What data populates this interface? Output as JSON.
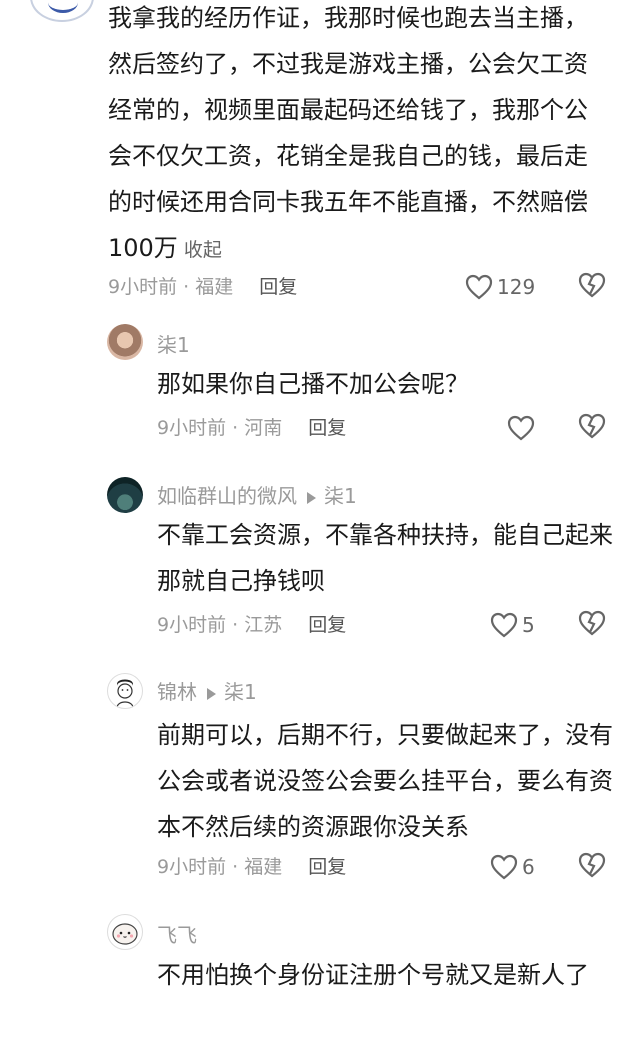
{
  "main_comment": {
    "text": "我拿我的经历作证，我那时候也跑去当主播，然后签约了，不过我是游戏主播，公会欠工资经常的，视频里面最起码还给钱了，我那个公会不仅欠工资，花销全是我自己的钱，最后走的时候还用合同卡我五年不能直播，不然赔偿100万",
    "expand_label": "收起",
    "time_location": "9小时前 · 福建",
    "reply_label": "回复",
    "likes": "129"
  },
  "replies": [
    {
      "name": "柒1",
      "reply_to": "",
      "text": "那如果你自己播不加公会呢？",
      "time_location": "9小时前 · 河南",
      "reply_label": "回复",
      "likes": ""
    },
    {
      "name": "如临群山的微风",
      "reply_to": "柒1",
      "text": "不靠工会资源，不靠各种扶持，能自己起来那就自己挣钱呗",
      "time_location": "9小时前 · 江苏",
      "reply_label": "回复",
      "likes": "5"
    },
    {
      "name": "锦林",
      "reply_to": "柒1",
      "text": "前期可以，后期不行，只要做起来了，没有公会或者说没签公会要么挂平台，要么有资本不然后续的资源跟你没关系",
      "time_location": "9小时前 · 福建",
      "reply_label": "回复",
      "likes": "6"
    },
    {
      "name": "飞飞",
      "reply_to": "",
      "text": "不用怕换个身份证注册个号就又是新人了"
    }
  ],
  "icons": {
    "like": "heart-outline-icon",
    "dislike": "broken-heart-icon",
    "reply_arrow": "triangle-right-icon"
  },
  "colors": {
    "text": "#1a1a1a",
    "meta": "#9a9a9a",
    "icon": "#666666"
  }
}
